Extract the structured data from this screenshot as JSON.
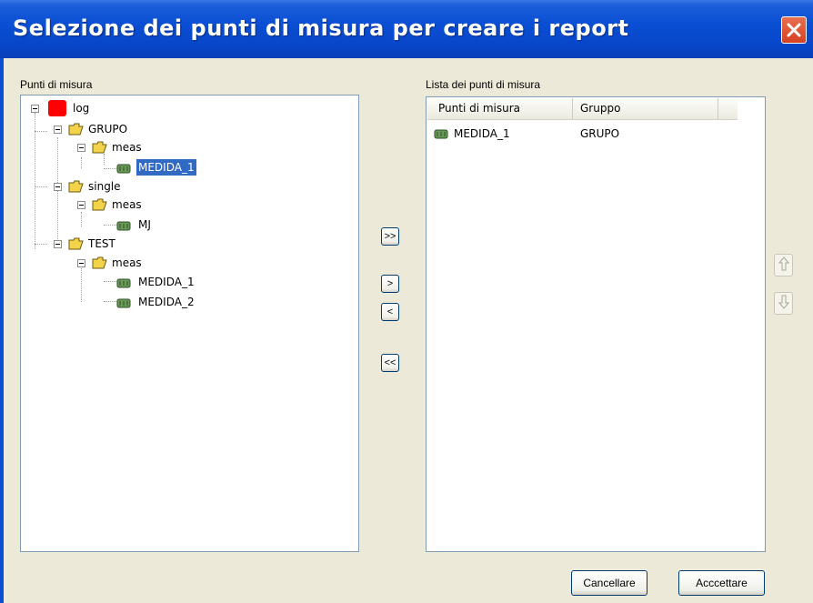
{
  "window": {
    "title": "Selezione dei punti di misura per creare i report"
  },
  "left_panel": {
    "label": "Punti di misura",
    "tree": {
      "root": "log",
      "grupo": "GRUPO",
      "grupo_meas": "meas",
      "grupo_meas_item": "MEDIDA_1",
      "single": "single",
      "single_meas": "meas",
      "single_meas_item": "MJ",
      "test": "TEST",
      "test_meas": "meas",
      "test_meas_item1": "MEDIDA_1",
      "test_meas_item2": "MEDIDA_2"
    }
  },
  "move_buttons": {
    "add_all": ">>",
    "add_one": ">",
    "remove_one": "<",
    "remove_all": "<<"
  },
  "right_panel": {
    "label": "Lista dei punti di misura",
    "columns": [
      "Punti di misura",
      "Gruppo"
    ],
    "rows": [
      {
        "punto": "MEDIDA_1",
        "gruppo": "GRUPO"
      }
    ]
  },
  "order_buttons": {
    "up_icon": "arrow-up-icon",
    "down_icon": "arrow-down-icon"
  },
  "footer": {
    "cancel": "Cancellare",
    "accept": "Acccettare"
  },
  "colors": {
    "titlebar": "#0a4fd4",
    "selection": "#316ac5",
    "root_icon": "#ff0000",
    "folder": "#f3d34a",
    "leaf": "#5a8a4a"
  }
}
